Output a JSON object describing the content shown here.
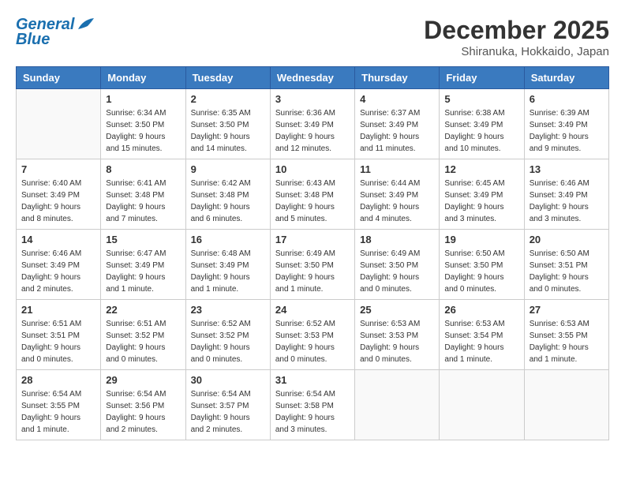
{
  "header": {
    "logo_line1": "General",
    "logo_line2": "Blue",
    "month": "December 2025",
    "location": "Shiranuka, Hokkaido, Japan"
  },
  "weekdays": [
    "Sunday",
    "Monday",
    "Tuesday",
    "Wednesday",
    "Thursday",
    "Friday",
    "Saturday"
  ],
  "weeks": [
    [
      {
        "day": "",
        "sunrise": "",
        "sunset": "",
        "daylight": ""
      },
      {
        "day": "1",
        "sunrise": "Sunrise: 6:34 AM",
        "sunset": "Sunset: 3:50 PM",
        "daylight": "Daylight: 9 hours and 15 minutes."
      },
      {
        "day": "2",
        "sunrise": "Sunrise: 6:35 AM",
        "sunset": "Sunset: 3:50 PM",
        "daylight": "Daylight: 9 hours and 14 minutes."
      },
      {
        "day": "3",
        "sunrise": "Sunrise: 6:36 AM",
        "sunset": "Sunset: 3:49 PM",
        "daylight": "Daylight: 9 hours and 12 minutes."
      },
      {
        "day": "4",
        "sunrise": "Sunrise: 6:37 AM",
        "sunset": "Sunset: 3:49 PM",
        "daylight": "Daylight: 9 hours and 11 minutes."
      },
      {
        "day": "5",
        "sunrise": "Sunrise: 6:38 AM",
        "sunset": "Sunset: 3:49 PM",
        "daylight": "Daylight: 9 hours and 10 minutes."
      },
      {
        "day": "6",
        "sunrise": "Sunrise: 6:39 AM",
        "sunset": "Sunset: 3:49 PM",
        "daylight": "Daylight: 9 hours and 9 minutes."
      }
    ],
    [
      {
        "day": "7",
        "sunrise": "Sunrise: 6:40 AM",
        "sunset": "Sunset: 3:49 PM",
        "daylight": "Daylight: 9 hours and 8 minutes."
      },
      {
        "day": "8",
        "sunrise": "Sunrise: 6:41 AM",
        "sunset": "Sunset: 3:48 PM",
        "daylight": "Daylight: 9 hours and 7 minutes."
      },
      {
        "day": "9",
        "sunrise": "Sunrise: 6:42 AM",
        "sunset": "Sunset: 3:48 PM",
        "daylight": "Daylight: 9 hours and 6 minutes."
      },
      {
        "day": "10",
        "sunrise": "Sunrise: 6:43 AM",
        "sunset": "Sunset: 3:48 PM",
        "daylight": "Daylight: 9 hours and 5 minutes."
      },
      {
        "day": "11",
        "sunrise": "Sunrise: 6:44 AM",
        "sunset": "Sunset: 3:49 PM",
        "daylight": "Daylight: 9 hours and 4 minutes."
      },
      {
        "day": "12",
        "sunrise": "Sunrise: 6:45 AM",
        "sunset": "Sunset: 3:49 PM",
        "daylight": "Daylight: 9 hours and 3 minutes."
      },
      {
        "day": "13",
        "sunrise": "Sunrise: 6:46 AM",
        "sunset": "Sunset: 3:49 PM",
        "daylight": "Daylight: 9 hours and 3 minutes."
      }
    ],
    [
      {
        "day": "14",
        "sunrise": "Sunrise: 6:46 AM",
        "sunset": "Sunset: 3:49 PM",
        "daylight": "Daylight: 9 hours and 2 minutes."
      },
      {
        "day": "15",
        "sunrise": "Sunrise: 6:47 AM",
        "sunset": "Sunset: 3:49 PM",
        "daylight": "Daylight: 9 hours and 1 minute."
      },
      {
        "day": "16",
        "sunrise": "Sunrise: 6:48 AM",
        "sunset": "Sunset: 3:49 PM",
        "daylight": "Daylight: 9 hours and 1 minute."
      },
      {
        "day": "17",
        "sunrise": "Sunrise: 6:49 AM",
        "sunset": "Sunset: 3:50 PM",
        "daylight": "Daylight: 9 hours and 1 minute."
      },
      {
        "day": "18",
        "sunrise": "Sunrise: 6:49 AM",
        "sunset": "Sunset: 3:50 PM",
        "daylight": "Daylight: 9 hours and 0 minutes."
      },
      {
        "day": "19",
        "sunrise": "Sunrise: 6:50 AM",
        "sunset": "Sunset: 3:50 PM",
        "daylight": "Daylight: 9 hours and 0 minutes."
      },
      {
        "day": "20",
        "sunrise": "Sunrise: 6:50 AM",
        "sunset": "Sunset: 3:51 PM",
        "daylight": "Daylight: 9 hours and 0 minutes."
      }
    ],
    [
      {
        "day": "21",
        "sunrise": "Sunrise: 6:51 AM",
        "sunset": "Sunset: 3:51 PM",
        "daylight": "Daylight: 9 hours and 0 minutes."
      },
      {
        "day": "22",
        "sunrise": "Sunrise: 6:51 AM",
        "sunset": "Sunset: 3:52 PM",
        "daylight": "Daylight: 9 hours and 0 minutes."
      },
      {
        "day": "23",
        "sunrise": "Sunrise: 6:52 AM",
        "sunset": "Sunset: 3:52 PM",
        "daylight": "Daylight: 9 hours and 0 minutes."
      },
      {
        "day": "24",
        "sunrise": "Sunrise: 6:52 AM",
        "sunset": "Sunset: 3:53 PM",
        "daylight": "Daylight: 9 hours and 0 minutes."
      },
      {
        "day": "25",
        "sunrise": "Sunrise: 6:53 AM",
        "sunset": "Sunset: 3:53 PM",
        "daylight": "Daylight: 9 hours and 0 minutes."
      },
      {
        "day": "26",
        "sunrise": "Sunrise: 6:53 AM",
        "sunset": "Sunset: 3:54 PM",
        "daylight": "Daylight: 9 hours and 1 minute."
      },
      {
        "day": "27",
        "sunrise": "Sunrise: 6:53 AM",
        "sunset": "Sunset: 3:55 PM",
        "daylight": "Daylight: 9 hours and 1 minute."
      }
    ],
    [
      {
        "day": "28",
        "sunrise": "Sunrise: 6:54 AM",
        "sunset": "Sunset: 3:55 PM",
        "daylight": "Daylight: 9 hours and 1 minute."
      },
      {
        "day": "29",
        "sunrise": "Sunrise: 6:54 AM",
        "sunset": "Sunset: 3:56 PM",
        "daylight": "Daylight: 9 hours and 2 minutes."
      },
      {
        "day": "30",
        "sunrise": "Sunrise: 6:54 AM",
        "sunset": "Sunset: 3:57 PM",
        "daylight": "Daylight: 9 hours and 2 minutes."
      },
      {
        "day": "31",
        "sunrise": "Sunrise: 6:54 AM",
        "sunset": "Sunset: 3:58 PM",
        "daylight": "Daylight: 9 hours and 3 minutes."
      },
      {
        "day": "",
        "sunrise": "",
        "sunset": "",
        "daylight": ""
      },
      {
        "day": "",
        "sunrise": "",
        "sunset": "",
        "daylight": ""
      },
      {
        "day": "",
        "sunrise": "",
        "sunset": "",
        "daylight": ""
      }
    ]
  ]
}
